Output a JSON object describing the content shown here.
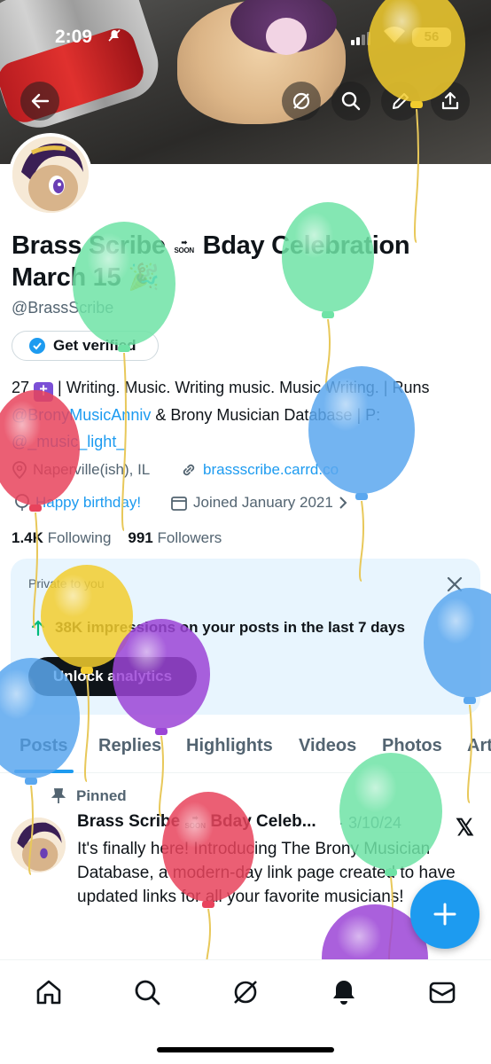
{
  "status_bar": {
    "time": "2:09",
    "battery": "56"
  },
  "profile": {
    "display_name": "Brass Scribe",
    "soon_badge": "SOON",
    "display_name_rest": "Bday Celebration March 15",
    "handle": "@BrassScribe",
    "get_verified": "Get verified",
    "bio": {
      "age": "27",
      "line1": " | Writing. Music. Writing music. Music Writing. | Runs ",
      "link1": "@BronyMusicAnniv",
      "line2": " & Brony Musician Database | P: ",
      "link2": "@_music_light_"
    },
    "location": "Naperville(ish), IL",
    "website": "brassscribe.carrd.co",
    "birthday": "Happy birthday!",
    "joined": "Joined January 2021",
    "following_count": "1.4K",
    "following_label": "Following",
    "followers_count": "991",
    "followers_label": "Followers"
  },
  "analytics": {
    "private_label": "Private to you",
    "impressions": "38K impressions on your posts in the last 7 days",
    "unlock_label": "Unlock analytics"
  },
  "tabs": [
    "Posts",
    "Replies",
    "Highlights",
    "Videos",
    "Photos",
    "Art"
  ],
  "pinned_post": {
    "pinned_label": "Pinned",
    "author": "Brass Scribe",
    "author_rest": "Bday Celeb...",
    "soon_badge": "SOON",
    "date": "· 3/10/24",
    "body": "It's finally here! Introducing The Brony Musician Database, a modern-day link page created to have updated links for all your favorite musicians!"
  },
  "colors": {
    "accent": "#1d9bf0",
    "balloon_yellow": "#f2cc2e",
    "balloon_green": "#6fe3a6",
    "balloon_blue": "#5aa7ef",
    "balloon_red": "#e8435c",
    "balloon_purple": "#9b44d6"
  },
  "icons": {
    "back": "arrow-left-icon",
    "grok": "grok-icon",
    "search": "search-icon",
    "edit": "pencil-icon",
    "share": "share-icon",
    "home": "home-icon",
    "notifications": "bell-icon",
    "messages": "mail-icon",
    "compose": "plus-icon"
  }
}
